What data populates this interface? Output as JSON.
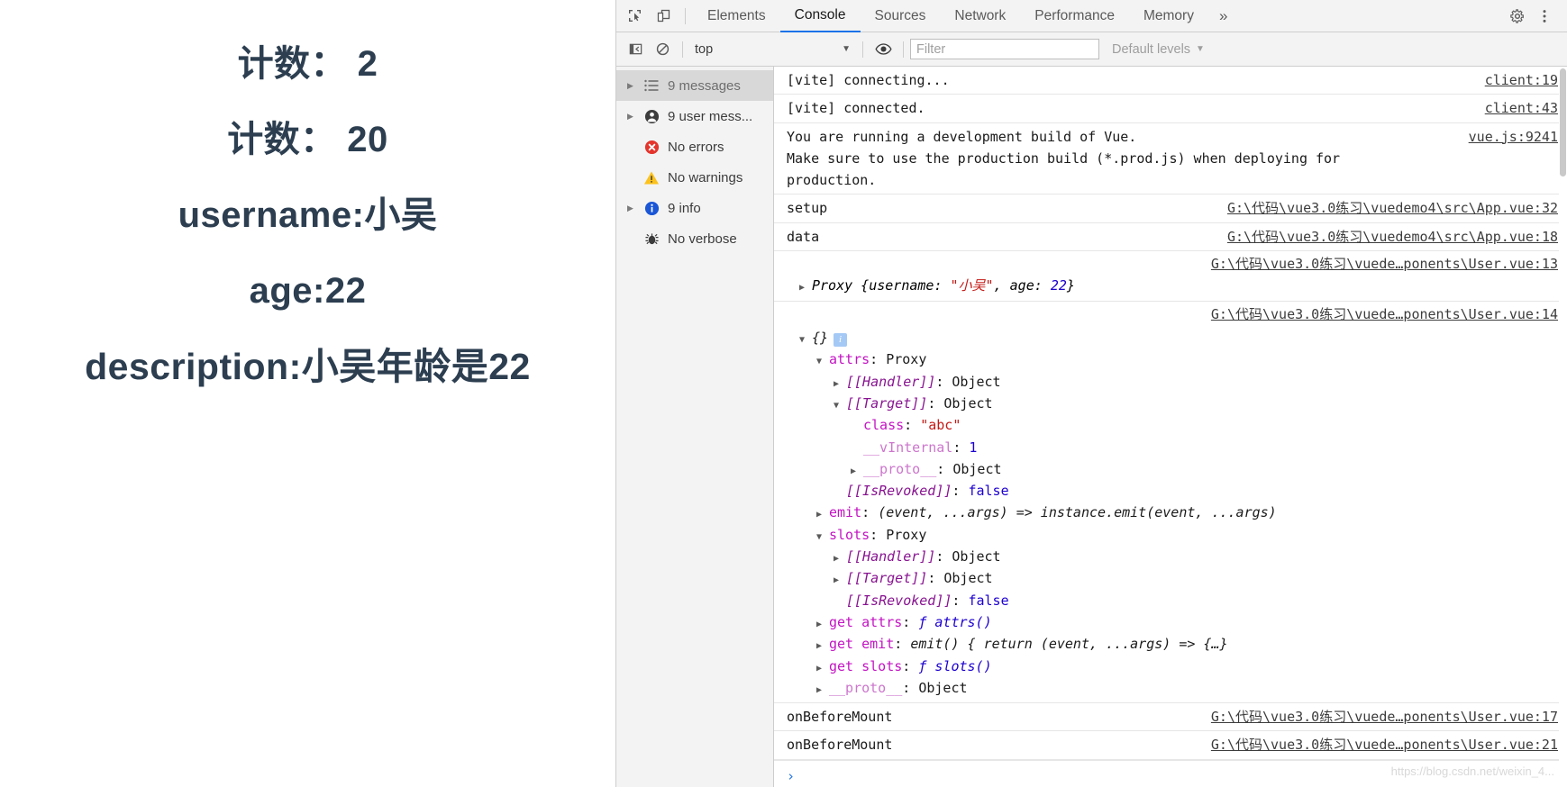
{
  "page": {
    "lines": [
      "计数： 2",
      "计数： 20",
      "username:小吴",
      "age:22",
      "description:小吴年龄是22"
    ]
  },
  "devtools": {
    "toolbar": {
      "inspect_icon": "inspect-element-icon",
      "device_icon": "device-toolbar-icon",
      "settings_icon": "gear-icon",
      "menu_icon": "more-vertical-icon",
      "more_tabs_label": "»"
    },
    "tabs": [
      {
        "label": "Elements",
        "active": false
      },
      {
        "label": "Console",
        "active": true
      },
      {
        "label": "Sources",
        "active": false
      },
      {
        "label": "Network",
        "active": false
      },
      {
        "label": "Performance",
        "active": false
      },
      {
        "label": "Memory",
        "active": false
      }
    ],
    "console_toolbar": {
      "sidebar_toggle_icon": "show-console-sidebar-icon",
      "clear_icon": "clear-console-icon",
      "context_value": "top",
      "context_caret": "▼",
      "eye_icon": "live-expression-icon",
      "filter_value": "",
      "filter_placeholder": "Filter",
      "levels_label": "Default levels",
      "levels_caret": "▼"
    },
    "sidebar": [
      {
        "label": "9 messages",
        "icon": "list-icon",
        "arrow": true,
        "selected": true
      },
      {
        "label": "9 user mess...",
        "icon": "user-icon",
        "arrow": true,
        "selected": false
      },
      {
        "label": "No errors",
        "icon": "error-icon",
        "arrow": false,
        "selected": false
      },
      {
        "label": "No warnings",
        "icon": "warning-icon",
        "arrow": false,
        "selected": false
      },
      {
        "label": "9 info",
        "icon": "info-icon",
        "arrow": true,
        "selected": false
      },
      {
        "label": "No verbose",
        "icon": "bug-icon",
        "arrow": false,
        "selected": false
      }
    ],
    "messages": [
      {
        "text": "[vite] connecting...",
        "source": "client:19"
      },
      {
        "text": "[vite] connected.",
        "source": "client:43"
      },
      {
        "text": "You are running a development build of Vue.\nMake sure to use the production build (*.prod.js) when deploying for\nproduction.",
        "source": "vue.js:9241"
      },
      {
        "text": "setup",
        "source": "G:\\代码\\vue3.0练习\\vuedemo4\\src\\App.vue:32"
      },
      {
        "text": "data",
        "source": "G:\\代码\\vue3.0练习\\vuedemo4\\src\\App.vue:18"
      }
    ],
    "proxy_summary": {
      "source": "G:\\代码\\vue3.0练习\\vuede…ponents\\User.vue:13",
      "prefix": "Proxy {username: ",
      "username": "\"小吴\"",
      "suffix": ", age: ",
      "age": "22",
      "close": "}"
    },
    "object_tree": {
      "source": "G:\\代码\\vue3.0练习\\vuede…ponents\\User.vue:14",
      "root_label": "{}",
      "info_badge": "i",
      "nodes": [
        {
          "indent": 1,
          "tri": "open",
          "key": "attrs",
          "key_style": "purple",
          "sep": ": ",
          "value": "Proxy",
          "value_style": "plain"
        },
        {
          "indent": 2,
          "tri": "closed",
          "key": "[[Handler]]",
          "key_style": "italic-purple",
          "sep": ": ",
          "value": "Object",
          "value_style": "plain"
        },
        {
          "indent": 2,
          "tri": "open",
          "key": "[[Target]]",
          "key_style": "italic-purple",
          "sep": ": ",
          "value": "Object",
          "value_style": "plain"
        },
        {
          "indent": 3,
          "tri": "none",
          "key": "class",
          "key_style": "purple",
          "sep": ": ",
          "value": "\"abc\"",
          "value_style": "string"
        },
        {
          "indent": 3,
          "tri": "none",
          "key": "__vInternal",
          "key_style": "light-purple",
          "sep": ": ",
          "value": "1",
          "value_style": "num"
        },
        {
          "indent": 3,
          "tri": "closed",
          "key": "__proto__",
          "key_style": "light-purple",
          "sep": ": ",
          "value": "Object",
          "value_style": "plain"
        },
        {
          "indent": 2,
          "tri": "none",
          "key": "[[IsRevoked]]",
          "key_style": "italic-purple",
          "sep": ": ",
          "value": "false",
          "value_style": "bool"
        },
        {
          "indent": 1,
          "tri": "closed",
          "key": "emit",
          "key_style": "purple",
          "sep": ": ",
          "value": "(event, ...args) => instance.emit(event, ...args)",
          "value_style": "fn"
        },
        {
          "indent": 1,
          "tri": "open",
          "key": "slots",
          "key_style": "purple",
          "sep": ": ",
          "value": "Proxy",
          "value_style": "plain"
        },
        {
          "indent": 2,
          "tri": "closed",
          "key": "[[Handler]]",
          "key_style": "italic-purple",
          "sep": ": ",
          "value": "Object",
          "value_style": "plain"
        },
        {
          "indent": 2,
          "tri": "closed",
          "key": "[[Target]]",
          "key_style": "italic-purple",
          "sep": ": ",
          "value": "Object",
          "value_style": "plain"
        },
        {
          "indent": 2,
          "tri": "none",
          "key": "[[IsRevoked]]",
          "key_style": "italic-purple",
          "sep": ": ",
          "value": "false",
          "value_style": "bool"
        },
        {
          "indent": 1,
          "tri": "closed",
          "key": "get attrs",
          "key_style": "purple",
          "sep": ": ",
          "value": "ƒ attrs()",
          "value_style": "fnkey"
        },
        {
          "indent": 1,
          "tri": "closed",
          "key": "get emit",
          "key_style": "purple",
          "sep": ": ",
          "value": "emit() { return (event, ...args) => {…}",
          "value_style": "fn"
        },
        {
          "indent": 1,
          "tri": "closed",
          "key": "get slots",
          "key_style": "purple",
          "sep": ": ",
          "value": "ƒ slots()",
          "value_style": "fnkey"
        },
        {
          "indent": 1,
          "tri": "closed",
          "key": "__proto__",
          "key_style": "light-purple",
          "sep": ": ",
          "value": "Object",
          "value_style": "plain"
        }
      ]
    },
    "tail_messages": [
      {
        "text": "onBeforeMount",
        "source": "G:\\代码\\vue3.0练习\\vuede…ponents\\User.vue:17"
      },
      {
        "text": "onBeforeMount",
        "source": "G:\\代码\\vue3.0练习\\vuede…ponents\\User.vue:21"
      }
    ],
    "prompt_symbol": "›",
    "watermark": "https://blog.csdn.net/weixin_4..."
  },
  "colors": {
    "accent": "#1a73e8",
    "page_text": "#2c3e50",
    "string": "#c41a16",
    "number": "#1c00cf",
    "key_purple": "#c314c3"
  }
}
